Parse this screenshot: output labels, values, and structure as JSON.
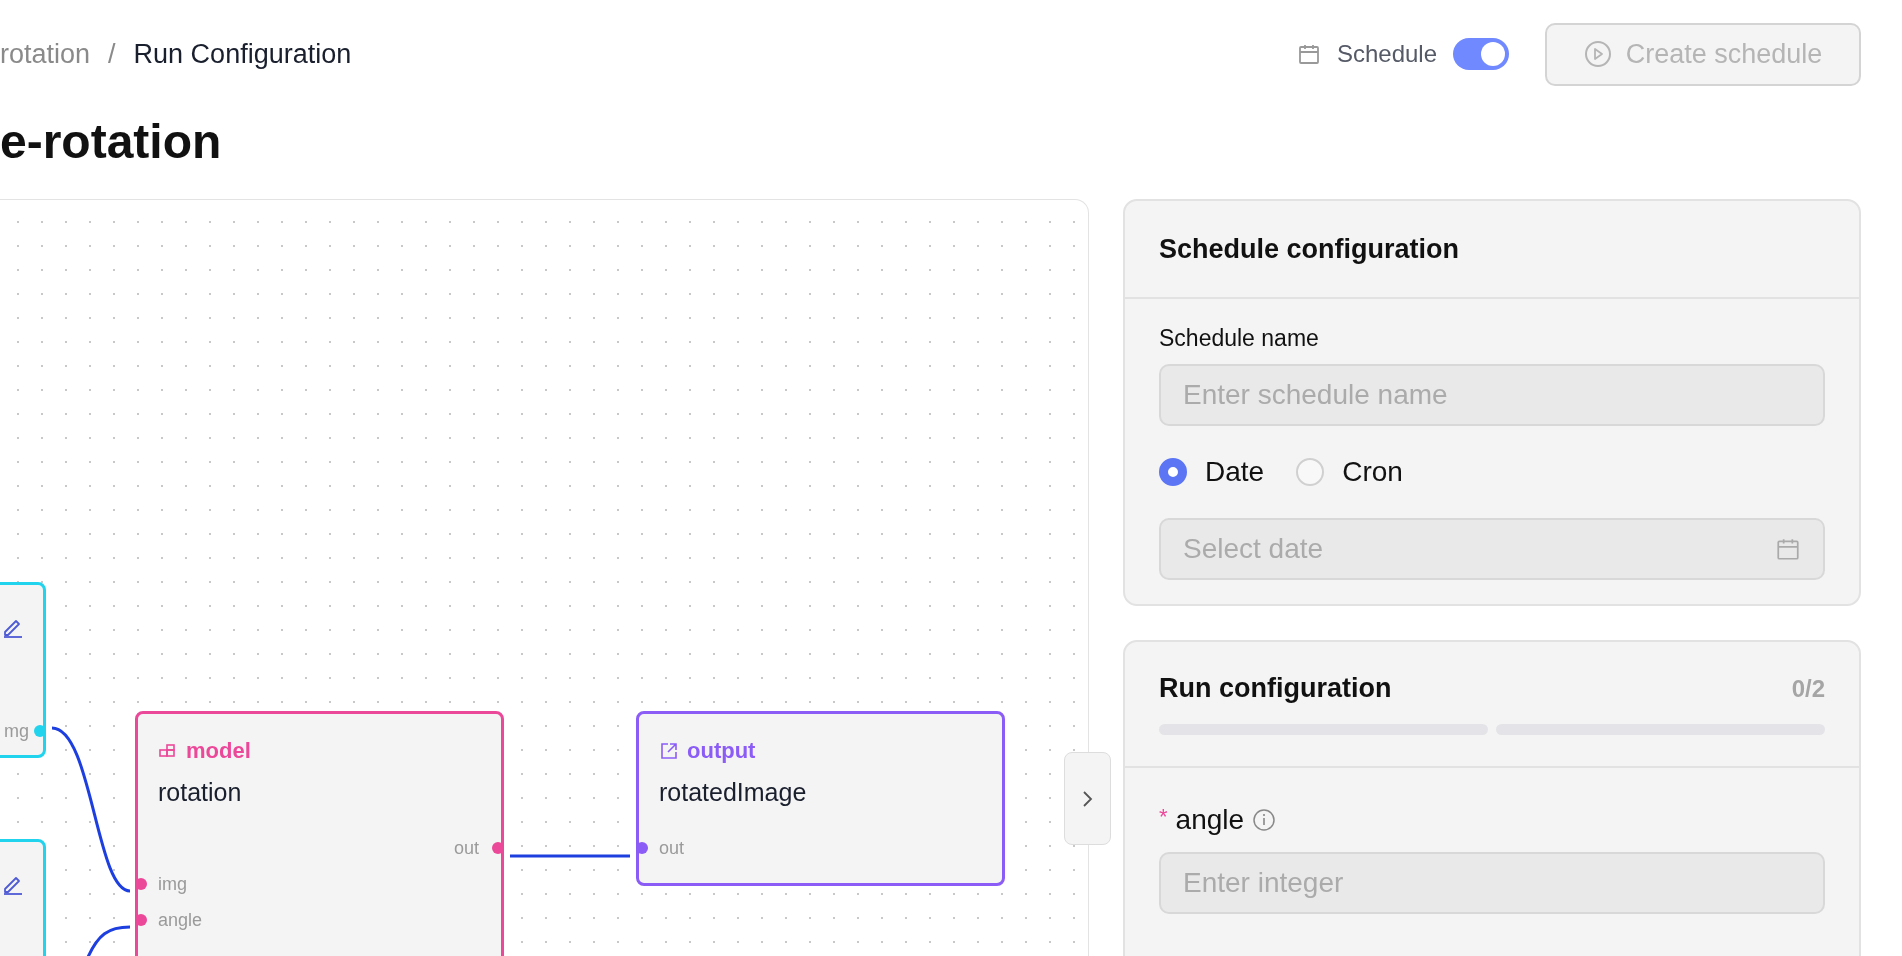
{
  "breadcrumb": [
    {
      "label": "rotation",
      "current": false
    },
    {
      "separator": "/",
      "label": "Run Configuration",
      "current": true
    }
  ],
  "title": "e-rotation",
  "header": {
    "schedule_label": "Schedule",
    "schedule_toggle": {
      "on": true
    },
    "create_button": {
      "label": "Create schedule",
      "disabled": true
    }
  },
  "canvas": {
    "nodes": [
      {
        "kind": "input",
        "color": "#22d3ee",
        "outputs": [
          "mg"
        ]
      },
      {
        "kind": "input",
        "color": "#22d3ee"
      },
      {
        "kind": "model",
        "color": "#ec4899",
        "tag": "model",
        "name": "rotation",
        "inputs": [
          "img",
          "angle"
        ],
        "outputs": [
          "out"
        ]
      },
      {
        "kind": "output",
        "color": "#8b5cf6",
        "tag": "output",
        "name": "rotatedImage",
        "inputs": [
          "out"
        ]
      }
    ]
  },
  "schedule_config": {
    "title": "Schedule configuration",
    "name_label": "Schedule name",
    "name_placeholder": "Enter schedule name",
    "modes": [
      {
        "label": "Date",
        "selected": true
      },
      {
        "label": "Cron",
        "selected": false
      }
    ],
    "date_placeholder": "Select date"
  },
  "run_config": {
    "title": "Run configuration",
    "count": "0/2",
    "steps": [
      {
        "done": false
      },
      {
        "done": false
      }
    ],
    "fields": [
      {
        "label": "angle",
        "required_mark": "*",
        "placeholder": "Enter integer"
      }
    ]
  }
}
